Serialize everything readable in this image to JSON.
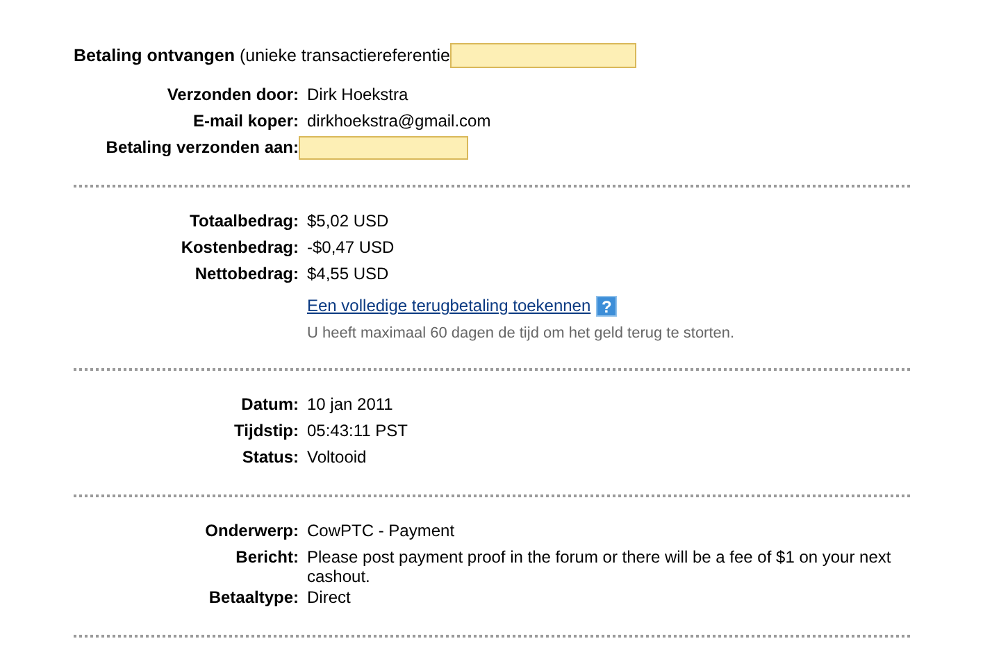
{
  "header": {
    "text": "**Betaling ontvangen** (unieke transactiereferentie",
    "redacted": true
  },
  "sections": [
    {
      "rows": [
        {
          "kind": "text",
          "label": "Verzonden door:",
          "value": "Dirk Hoekstra"
        },
        {
          "kind": "text",
          "label": "E-mail koper:",
          "value": "dirkhoekstra@gmail.com"
        },
        {
          "kind": "redacted",
          "label": "Betaling verzonden aan:"
        }
      ]
    },
    {
      "rows": [
        {
          "kind": "text",
          "label": "Totaalbedrag:",
          "value": "$5,02 USD"
        },
        {
          "kind": "text",
          "label": "Kostenbedrag:",
          "value": "-$0,47 USD"
        },
        {
          "kind": "text",
          "label": "Nettobedrag:",
          "value": "$4,55 USD"
        },
        {
          "kind": "link",
          "value": "Een volledige terugbetaling toekennen",
          "help": "?"
        },
        {
          "kind": "note",
          "value": "U heeft maximaal 60 dagen de tijd om het geld terug te storten."
        }
      ]
    },
    {
      "rows": [
        {
          "kind": "text",
          "label": "Datum:",
          "value": "10 jan 2011"
        },
        {
          "kind": "text",
          "label": "Tijdstip:",
          "value": "05:43:11 PST"
        },
        {
          "kind": "text",
          "label": "Status:",
          "value": "Voltooid"
        }
      ]
    },
    {
      "rows": [
        {
          "kind": "text",
          "label": "Onderwerp:",
          "value": "CowPTC - Payment"
        },
        {
          "kind": "text",
          "label": "Bericht:",
          "value": "Please post payment proof in the forum or there will be a fee of $1 on your next cashout."
        },
        {
          "kind": "text",
          "label": "Betaaltype:",
          "value": "Direct"
        }
      ]
    }
  ]
}
